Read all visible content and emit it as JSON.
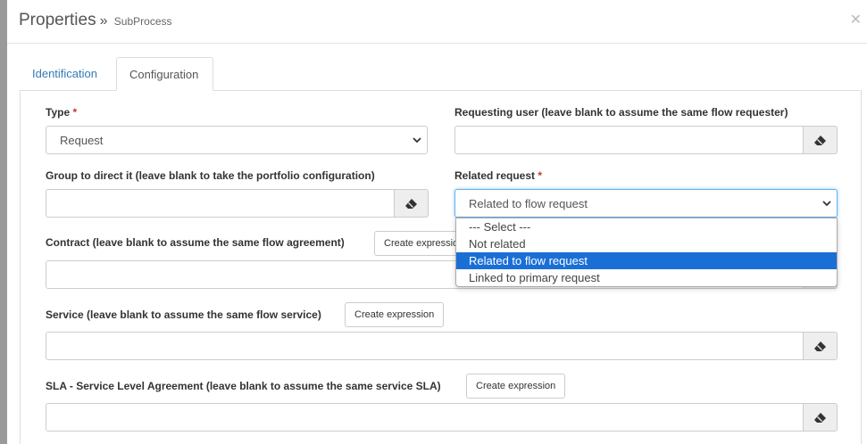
{
  "header": {
    "title": "Properties",
    "separator": "»",
    "subtitle": "SubProcess"
  },
  "tabs": [
    {
      "label": "Identification",
      "active": false
    },
    {
      "label": "Configuration",
      "active": true
    }
  ],
  "form": {
    "type": {
      "label": "Type",
      "required": "*",
      "value": "Request"
    },
    "requesting_user": {
      "label": "Requesting user (leave blank to assume the same flow requester)",
      "value": ""
    },
    "group": {
      "label": "Group to direct it (leave blank to take the portfolio configuration)",
      "value": ""
    },
    "related_request": {
      "label": "Related request",
      "required": "*",
      "value": "Related to flow request",
      "options": [
        "--- Select ---",
        "Not related",
        "Related to flow request",
        "Linked to primary request"
      ],
      "selected_index": 2
    },
    "contract": {
      "label": "Contract (leave blank to assume the same flow agreement)",
      "button": "Create expression",
      "value": ""
    },
    "service": {
      "label": "Service (leave blank to assume the same flow service)",
      "button": "Create expression",
      "value": ""
    },
    "sla": {
      "label": "SLA - Service Level Agreement (leave blank to assume the same service SLA)",
      "button": "Create expression",
      "value": ""
    }
  },
  "icons": {
    "clear": "eraser-icon",
    "close": "close-icon",
    "dropdown": "chevron-down-icon"
  },
  "colors": {
    "accent": "#1a6fd6",
    "link": "#337ab7",
    "required": "#c0392b"
  }
}
